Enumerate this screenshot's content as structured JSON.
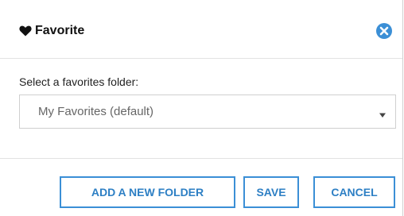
{
  "dialog": {
    "title": "Favorite",
    "title_icon": "heart-icon",
    "close_icon": "close-circle-icon"
  },
  "form": {
    "label": "Select a favorites folder:",
    "selected_folder": "My Favorites (default)",
    "dropdown_icon": "triangle-down-icon"
  },
  "actions": {
    "add_folder_label": "ADD A NEW FOLDER",
    "save_label": "SAVE",
    "cancel_label": "CANCEL"
  },
  "colors": {
    "accent": "#3b8fd6",
    "text": "#111111",
    "muted_text": "#666666",
    "border": "#cfcfcf"
  }
}
